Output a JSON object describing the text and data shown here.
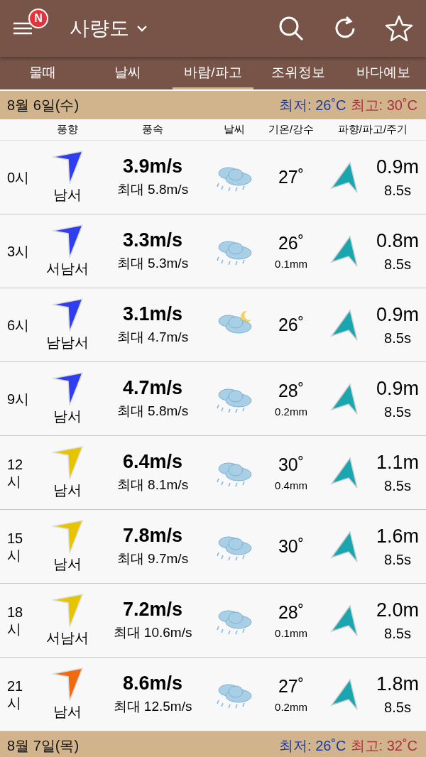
{
  "header": {
    "badge": "N",
    "location": "사량도"
  },
  "tabs": [
    {
      "label": "물때",
      "selected": false
    },
    {
      "label": "날씨",
      "selected": false
    },
    {
      "label": "바람/파고",
      "selected": true
    },
    {
      "label": "조위정보",
      "selected": false
    },
    {
      "label": "바다예보",
      "selected": false
    }
  ],
  "days": [
    {
      "date": "8월 6일(수)",
      "min": "최저: 26˚C",
      "max": "최고: 30˚C",
      "columns": [
        "풍향",
        "풍속",
        "날씨",
        "기온/강수",
        "파향/파고/주기"
      ],
      "rows": [
        {
          "time": "0시",
          "wind_dir": "남서",
          "color": "#2f3ff0",
          "speed": "3.9m/s",
          "gust": "최대 5.8m/s",
          "kind": "rain",
          "temp": "27˚",
          "wave": "0.9m",
          "period": "8.5s"
        },
        {
          "time": "3시",
          "wind_dir": "서남서",
          "color": "#2f3ff0",
          "speed": "3.3m/s",
          "gust": "최대 5.3m/s",
          "kind": "rain",
          "temp": "26˚",
          "precip": "0.1mm",
          "wave": "0.8m",
          "period": "8.5s"
        },
        {
          "time": "6시",
          "wind_dir": "남남서",
          "color": "#2f3ff0",
          "speed": "3.1m/s",
          "gust": "최대 4.7m/s",
          "kind": "cloud-moon",
          "temp": "26˚",
          "wave": "0.9m",
          "period": "8.5s"
        },
        {
          "time": "9시",
          "wind_dir": "남서",
          "color": "#2f3ff0",
          "speed": "4.7m/s",
          "gust": "최대 5.8m/s",
          "kind": "rain",
          "temp": "28˚",
          "precip": "0.2mm",
          "wave": "0.9m",
          "period": "8.5s"
        },
        {
          "time": "12시",
          "wind_dir": "남서",
          "color": "#e6c400",
          "speed": "6.4m/s",
          "gust": "최대 8.1m/s",
          "kind": "rain",
          "temp": "30˚",
          "precip": "0.4mm",
          "wave": "1.1m",
          "period": "8.5s"
        },
        {
          "time": "15시",
          "wind_dir": "남서",
          "color": "#e6c400",
          "speed": "7.8m/s",
          "gust": "최대 9.7m/s",
          "kind": "rain",
          "temp": "30˚",
          "wave": "1.6m",
          "period": "8.5s"
        },
        {
          "time": "18시",
          "wind_dir": "서남서",
          "color": "#e6c400",
          "speed": "7.2m/s",
          "gust": "최대 10.6m/s",
          "kind": "rain",
          "temp": "28˚",
          "precip": "0.1mm",
          "wave": "2.0m",
          "period": "8.5s"
        },
        {
          "time": "21시",
          "wind_dir": "남서",
          "color": "#f06a10",
          "speed": "8.6m/s",
          "gust": "최대 12.5m/s",
          "kind": "rain",
          "temp": "27˚",
          "precip": "0.2mm",
          "wave": "1.8m",
          "period": "8.5s"
        }
      ]
    },
    {
      "date": "8월 7일(목)",
      "min": "최저: 26˚C",
      "max": "최고: 32˚C"
    }
  ]
}
